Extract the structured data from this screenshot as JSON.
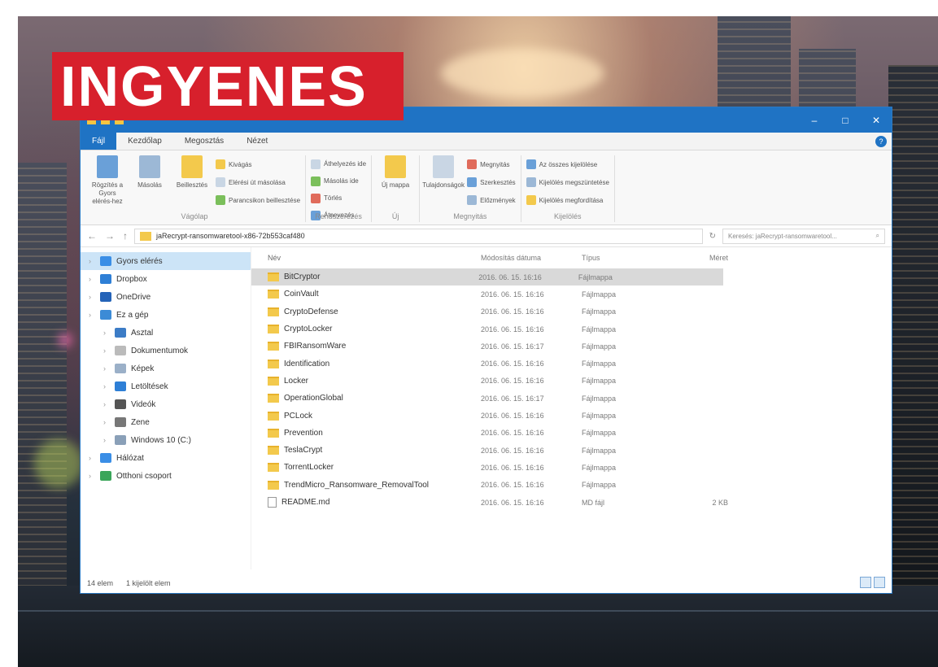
{
  "badge": {
    "text": "INGYENES",
    "color": "#d7202c"
  },
  "window": {
    "title": "",
    "accent": "#1f73c4",
    "controls": [
      "–",
      "□",
      "✕"
    ]
  },
  "menu": {
    "tabs": [
      "Fájl",
      "Kezdőlap",
      "Megosztás",
      "Nézet"
    ]
  },
  "ribbon": {
    "groups": [
      {
        "label": "Vágólap",
        "big": [
          "Rögzítés a Gyors elérés-hez",
          "Másolás",
          "Beillesztés"
        ],
        "small": [
          "Kivágás",
          "Elérési út másolása",
          "Parancsikon beillesztése"
        ]
      },
      {
        "label": "Rendszerezés",
        "small": [
          "Áthelyezés ide",
          "Másolás ide",
          "Törlés",
          "Átnevezés"
        ]
      },
      {
        "label": "Új",
        "big": [
          "Új mappa"
        ],
        "small": []
      },
      {
        "label": "Megnyitás",
        "big": [
          "Tulajdonságok"
        ],
        "small": [
          "Megnyitás",
          "Szerkesztés",
          "Előzmények"
        ]
      },
      {
        "label": "Kijelölés",
        "small": [
          "Az összes kijelölése",
          "Kijelölés megszüntetése",
          "Kijelölés megfordítása"
        ]
      }
    ]
  },
  "address": {
    "path": "jaRecrypt-ransomwaretool-x86-72b553caf480",
    "search_placeholder": "Keresés: jaRecrypt-ransomwaretool..."
  },
  "nav": [
    {
      "label": "Gyors elérés",
      "icon": "star-icon",
      "sel": true,
      "sub": false
    },
    {
      "label": "Dropbox",
      "icon": "dropbox-icon",
      "sel": false,
      "sub": false
    },
    {
      "label": "OneDrive",
      "icon": "cloud-icon",
      "sel": false,
      "sub": false
    },
    {
      "label": "Ez a gép",
      "icon": "computer-icon",
      "sel": false,
      "sub": false
    },
    {
      "label": "Asztal",
      "icon": "desktop-icon",
      "sel": false,
      "sub": true
    },
    {
      "label": "Dokumentumok",
      "icon": "document-icon",
      "sel": false,
      "sub": true
    },
    {
      "label": "Képek",
      "icon": "pictures-icon",
      "sel": false,
      "sub": true
    },
    {
      "label": "Letöltések",
      "icon": "download-icon",
      "sel": false,
      "sub": true
    },
    {
      "label": "Videók",
      "icon": "video-icon",
      "sel": false,
      "sub": true
    },
    {
      "label": "Zene",
      "icon": "music-icon",
      "sel": false,
      "sub": true
    },
    {
      "label": "Windows 10 (C:)",
      "icon": "drive-icon",
      "sel": false,
      "sub": true
    },
    {
      "label": "Hálózat",
      "icon": "network-icon",
      "sel": false,
      "sub": false
    },
    {
      "label": "Otthoni csoport",
      "icon": "homegroup-icon",
      "sel": false,
      "sub": false
    }
  ],
  "columns": [
    "Név",
    "Módosítás dátuma",
    "Típus",
    "Méret"
  ],
  "files": [
    {
      "name": "BitCryptor",
      "date": "2016. 06. 15. 16:16",
      "type": "Fájlmappa",
      "size": "",
      "folder": true
    },
    {
      "name": "CoinVault",
      "date": "2016. 06. 15. 16:16",
      "type": "Fájlmappa",
      "size": "",
      "folder": true
    },
    {
      "name": "CryptoDefense",
      "date": "2016. 06. 15. 16:16",
      "type": "Fájlmappa",
      "size": "",
      "folder": true
    },
    {
      "name": "CryptoLocker",
      "date": "2016. 06. 15. 16:16",
      "type": "Fájlmappa",
      "size": "",
      "folder": true
    },
    {
      "name": "FBIRansomWare",
      "date": "2016. 06. 15. 16:17",
      "type": "Fájlmappa",
      "size": "",
      "folder": true
    },
    {
      "name": "Identification",
      "date": "2016. 06. 15. 16:16",
      "type": "Fájlmappa",
      "size": "",
      "folder": true
    },
    {
      "name": "Locker",
      "date": "2016. 06. 15. 16:16",
      "type": "Fájlmappa",
      "size": "",
      "folder": true
    },
    {
      "name": "OperationGlobal",
      "date": "2016. 06. 15. 16:17",
      "type": "Fájlmappa",
      "size": "",
      "folder": true
    },
    {
      "name": "PCLock",
      "date": "2016. 06. 15. 16:16",
      "type": "Fájlmappa",
      "size": "",
      "folder": true
    },
    {
      "name": "Prevention",
      "date": "2016. 06. 15. 16:16",
      "type": "Fájlmappa",
      "size": "",
      "folder": true
    },
    {
      "name": "TeslaCrypt",
      "date": "2016. 06. 15. 16:16",
      "type": "Fájlmappa",
      "size": "",
      "folder": true
    },
    {
      "name": "TorrentLocker",
      "date": "2016. 06. 15. 16:16",
      "type": "Fájlmappa",
      "size": "",
      "folder": true
    },
    {
      "name": "TrendMicro_Ransomware_RemovalTool",
      "date": "2016. 06. 15. 16:16",
      "type": "Fájlmappa",
      "size": "",
      "folder": true
    },
    {
      "name": "README.md",
      "date": "2016. 06. 15. 16:16",
      "type": "MD fájl",
      "size": "2 KB",
      "folder": false
    }
  ],
  "status": {
    "count": "14 elem",
    "selected": "1 kijelölt elem"
  }
}
